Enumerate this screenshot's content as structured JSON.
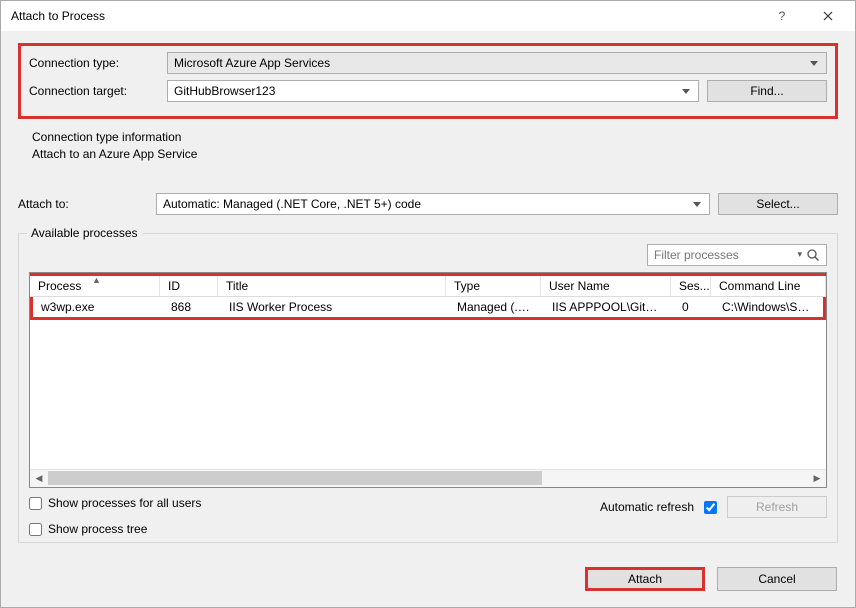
{
  "titlebar": {
    "title": "Attach to Process"
  },
  "connection": {
    "type_label": "Connection type:",
    "type_value": "Microsoft Azure App Services",
    "target_label": "Connection target:",
    "target_value": "GitHubBrowser123",
    "find_label": "Find..."
  },
  "info": {
    "line1": "Connection type information",
    "line2": "Attach to an Azure App Service"
  },
  "attach_to": {
    "label": "Attach to:",
    "value": "Automatic: Managed (.NET Core, .NET 5+) code",
    "select_label": "Select..."
  },
  "processes": {
    "legend": "Available processes",
    "filter_placeholder": "Filter processes",
    "columns": [
      "Process",
      "ID",
      "Title",
      "Type",
      "User Name",
      "Ses...",
      "Command Line"
    ],
    "rows": [
      {
        "process": "w3wp.exe",
        "id": "868",
        "title": "IIS Worker Process",
        "type": "Managed (.N...",
        "user": "IIS APPPOOL\\GitHub...",
        "session": "0",
        "cmd": "C:\\Windows\\SysW"
      }
    ],
    "show_all_label": "Show processes for all users",
    "show_tree_label": "Show process tree",
    "auto_refresh_label": "Automatic refresh",
    "refresh_label": "Refresh"
  },
  "buttons": {
    "attach": "Attach",
    "cancel": "Cancel"
  }
}
